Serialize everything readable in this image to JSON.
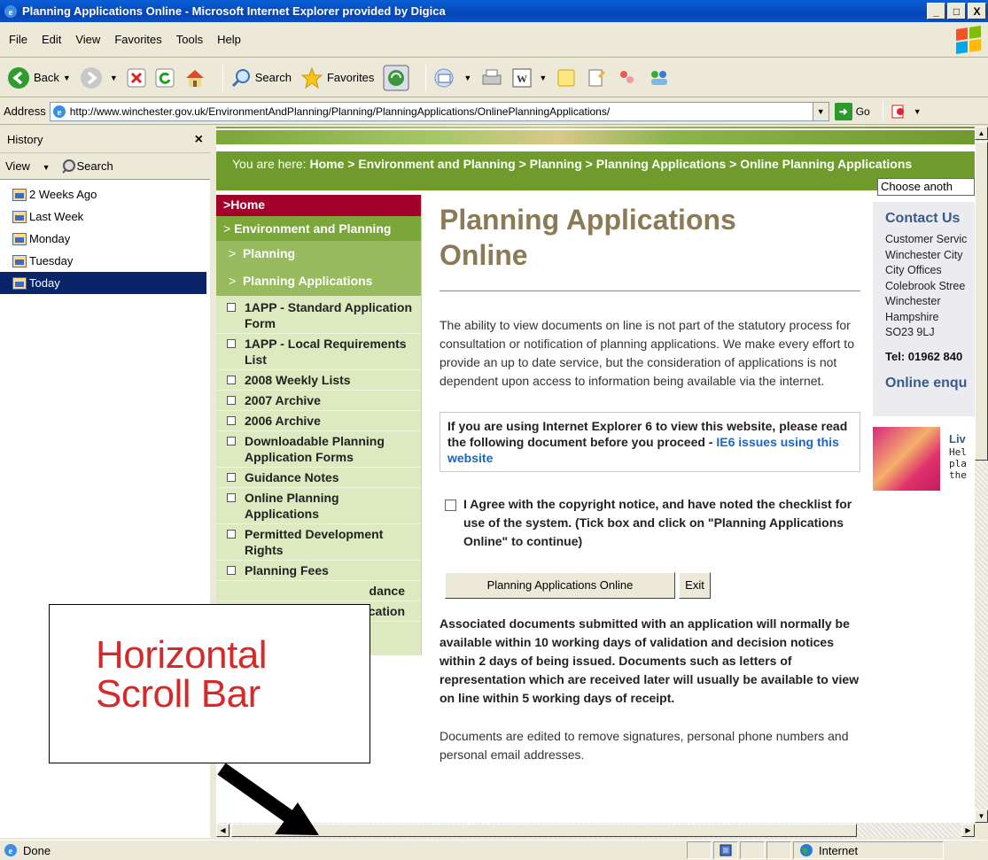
{
  "window": {
    "title": "Planning Applications Online - Microsoft Internet Explorer provided by Digica",
    "controls": [
      "_",
      "□",
      "X"
    ]
  },
  "menu": [
    "File",
    "Edit",
    "View",
    "Favorites",
    "Tools",
    "Help"
  ],
  "toolbar": {
    "back_label": "Back",
    "search_label": "Search",
    "favorites_label": "Favorites"
  },
  "address": {
    "label": "Address",
    "url": "http://www.winchester.gov.uk/EnvironmentAndPlanning/Planning/PlanningApplications/OnlinePlanningApplications/",
    "go_label": "Go"
  },
  "history": {
    "title": "History",
    "close": "×",
    "view_label": "View",
    "search_label": "Search",
    "items": [
      {
        "label": "2 Weeks Ago",
        "selected": false
      },
      {
        "label": "Last Week",
        "selected": false
      },
      {
        "label": "Monday",
        "selected": false
      },
      {
        "label": "Tuesday",
        "selected": false
      },
      {
        "label": "Today",
        "selected": true
      }
    ]
  },
  "breadcrumb": {
    "prefix": "You are here: ",
    "items": [
      "Home",
      "Environment and Planning",
      "Planning",
      "Planning Applications",
      "Online Planning Applications"
    ],
    "separator": " > "
  },
  "choose_select": "Choose anoth",
  "leftnav": {
    "home": "Home",
    "level1": "Environment and Planning",
    "level2": "Planning",
    "level3": "Planning Applications",
    "items": [
      "1APP - Standard Application Form",
      "1APP - Local Requirements List",
      "2008 Weekly Lists",
      "2007 Archive",
      "2006 Archive",
      "Downloadable Planning Application Forms",
      "Guidance Notes",
      "Online Planning Applications",
      "Permitted Development Rights",
      "Planning Fees",
      "dance",
      "cation"
    ]
  },
  "main": {
    "title": "Planning Applications Online",
    "intro": "The ability to view documents on line is not part of the statutory process for consultation or notification of planning applications. We make every effort to provide an up to date service, but the consideration of applications is not dependent upon access to information being available via the internet.",
    "notice_text": "If you are using Internet Explorer 6 to view this website, please read the following document before you proceed - ",
    "notice_link": "IE6 issues using this website",
    "agree_text": "I Agree with the copyright notice, and have noted the checklist for use of the system. (Tick box and click on \"Planning Applications Online\" to continue)",
    "btn_online": "Planning Applications Online",
    "btn_exit": "Exit",
    "associated": "Associated documents submitted with an application will normally be available within 10 working days of validation and decision notices within 2 days of being issued. Documents such as letters of representation which are received later will usually be available to view on line within 5 working days of receipt.",
    "edited": "Documents are edited to remove signatures, personal phone numbers and personal email addresses."
  },
  "contact": {
    "heading": "Contact Us",
    "lines": [
      "Customer Servic",
      "Winchester City",
      "City Offices",
      "Colebrook Stree",
      "Winchester",
      "Hampshire",
      "SO23 9LJ"
    ],
    "tel": "Tel: 01962 840",
    "online": "Online enqu"
  },
  "promo": {
    "title": "Liv",
    "lines": [
      "Hel",
      "pla",
      "the"
    ]
  },
  "status": {
    "text": "Done",
    "zone": "Internet"
  },
  "callout": {
    "line1": "Horizontal",
    "line2": "Scroll Bar"
  }
}
